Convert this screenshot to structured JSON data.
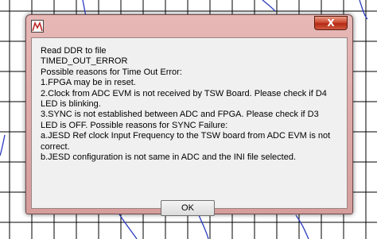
{
  "dialog": {
    "close_label": "X",
    "message_lines": [
      "Read DDR to file",
      "TIMED_OUT_ERROR",
      "Possible reasons for Time Out Error:",
      "1.FPGA may be in reset.",
      "2.Clock from ADC EVM is not received by TSW Board. Please check if D4",
      "LED is blinking.",
      "3.SYNC is not established between ADC and FPGA. Please check if D3",
      "LED is OFF. Possible reasons for SYNC Failure:",
      "a.JESD Ref clock Input Frequency to the TSW board from ADC EVM is not",
      "correct.",
      "b.JESD configuration is not same in ADC and the INI file selected."
    ],
    "ok_label": "OK"
  },
  "icons": {
    "app": "app-icon",
    "close": "close-icon"
  },
  "colors": {
    "frame": "#d9a3a2",
    "close_button": "#c8432c",
    "client": "#f0f0f0",
    "plot_line": "#2b3bbf"
  }
}
